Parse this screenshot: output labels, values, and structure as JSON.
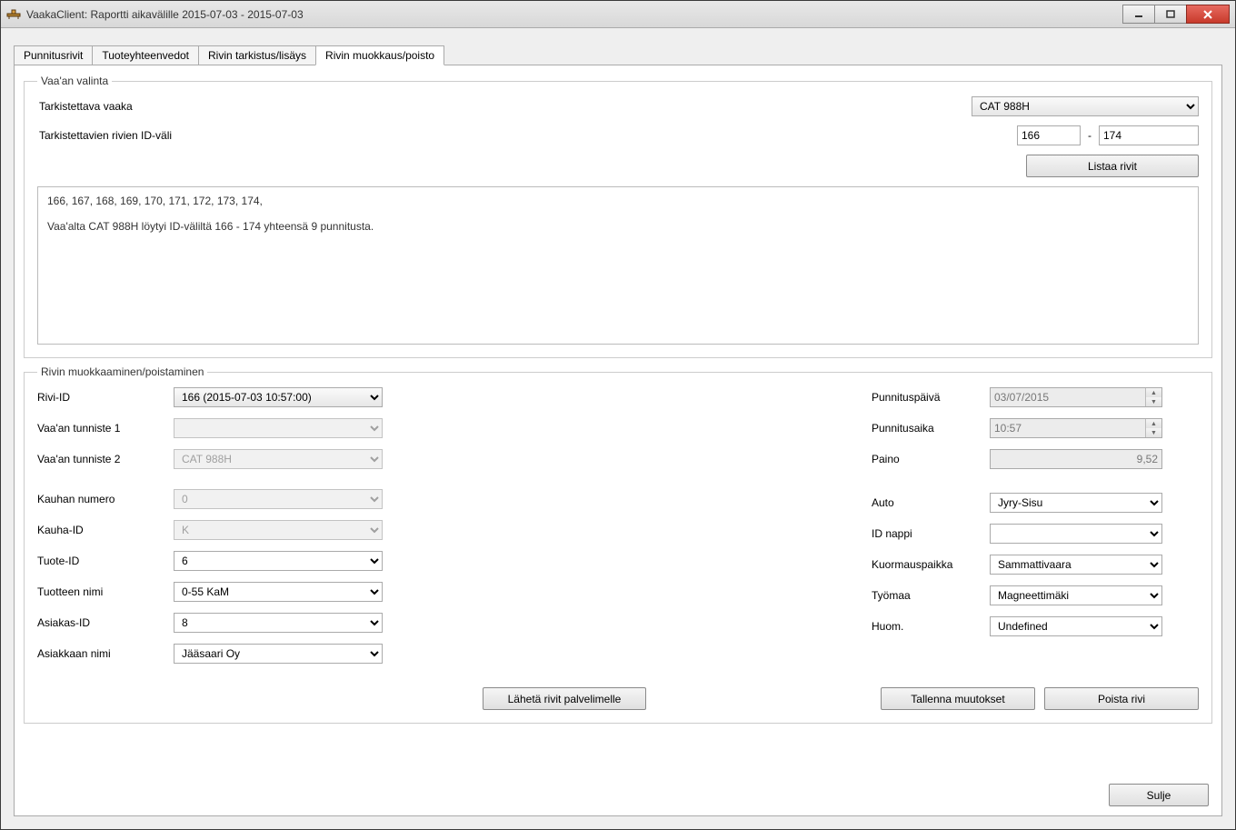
{
  "window": {
    "title": "VaakaClient: Raportti aikavälille 2015-07-03 - 2015-07-03"
  },
  "tabs": {
    "t1": "Punnitusrivit",
    "t2": "Tuoteyhteenvedot",
    "t3": "Rivin tarkistus/lisäys",
    "t4": "Rivin muokkaus/poisto"
  },
  "group1": {
    "legend": "Vaa'an valinta",
    "scale_label": "Tarkistettava vaaka",
    "scale_value": "CAT 988H",
    "idrange_label": "Tarkistettavien rivien ID-väli",
    "id_from": "166",
    "id_to": "174",
    "dash": "-",
    "list_btn": "Listaa rivit",
    "log": "166, 167, 168, 169, 170, 171, 172, 173, 174, \n\nVaa'alta CAT 988H löytyi ID-väliltä 166 - 174 yhteensä 9 punnitusta."
  },
  "group2": {
    "legend": "Rivin muokkaaminen/poistaminen",
    "left": {
      "row_id_label": "Rivi-ID",
      "row_id_value": "166 (2015-07-03 10:57:00)",
      "scale_tag1_label": "Vaa'an tunniste 1",
      "scale_tag1_value": "",
      "scale_tag2_label": "Vaa'an tunniste 2",
      "scale_tag2_value": "CAT 988H",
      "bucket_no_label": "Kauhan numero",
      "bucket_no_value": "0",
      "bucket_id_label": "Kauha-ID",
      "bucket_id_value": "K",
      "product_id_label": "Tuote-ID",
      "product_id_value": "6",
      "product_name_label": "Tuotteen nimi",
      "product_name_value": "0-55 KaM",
      "customer_id_label": "Asiakas-ID",
      "customer_id_value": "8",
      "customer_name_label": "Asiakkaan nimi",
      "customer_name_value": "Jääsaari Oy"
    },
    "right": {
      "weigh_date_label": "Punnituspäivä",
      "weigh_date_value": "03/07/2015",
      "weigh_time_label": "Punnitusaika",
      "weigh_time_value": "10:57",
      "weight_label": "Paino",
      "weight_value": "9,52",
      "vehicle_label": "Auto",
      "vehicle_value": "Jyry-Sisu",
      "idnappi_label": "ID nappi",
      "idnappi_value": "",
      "loadplace_label": "Kuormauspaikka",
      "loadplace_value": "Sammattivaara",
      "worksite_label": "Työmaa",
      "worksite_value": "Magneettimäki",
      "note_label": "Huom.",
      "note_value": "Undefined"
    },
    "send_btn": "Lähetä rivit palvelimelle",
    "save_btn": "Tallenna muutokset",
    "delete_btn": "Poista rivi"
  },
  "close_btn": "Sulje"
}
